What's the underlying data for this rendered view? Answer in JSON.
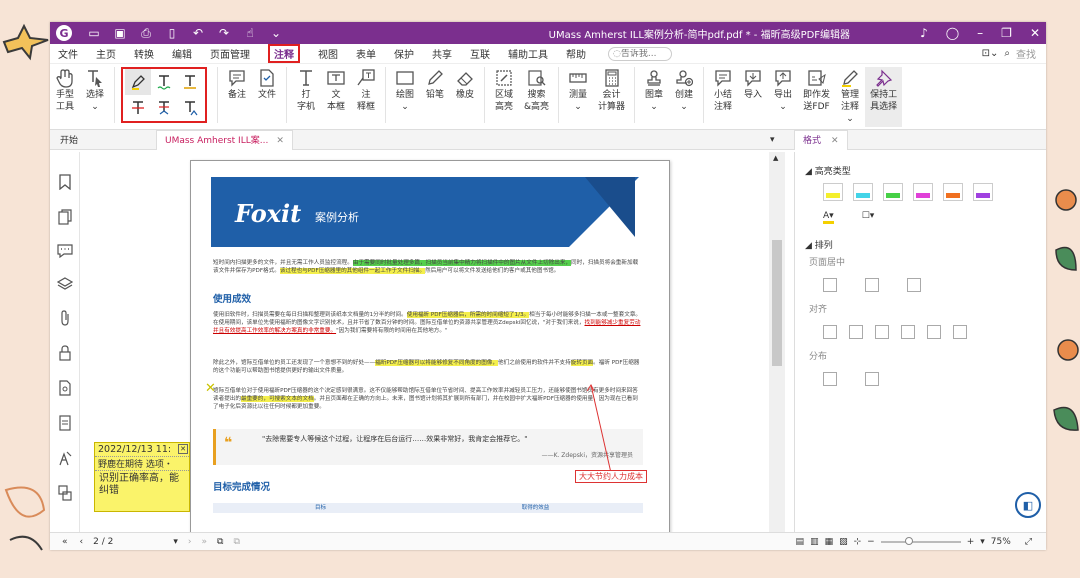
{
  "titlebar": {
    "app_logo": "G",
    "title": "UMass Amherst ILL案例分析-简中pdf.pdf * - 福昕高级PDF编辑器"
  },
  "menubar": {
    "items": [
      "文件",
      "主页",
      "转换",
      "编辑",
      "页面管理",
      "注释",
      "视图",
      "表单",
      "保护",
      "共享",
      "互联",
      "辅助工具",
      "帮助"
    ],
    "active_index": 5,
    "help_placeholder": "告诉我...",
    "search_label": "查找"
  },
  "ribbon": {
    "hand_tool": "手型\n工具",
    "select_tool": "选择",
    "note": "备注",
    "file": "文件",
    "typewriter": "打\n字机",
    "textbox": "文\n本框",
    "callout": "注\n释框",
    "drawing": "绘图",
    "pencil": "铅笔",
    "eraser": "橡皮",
    "area_highlight": "区域\n高亮",
    "search_highlight": "搜索\n&高亮",
    "measure": "测量",
    "calculator": "会计\n计算器",
    "stamp": "图章",
    "create": "创建",
    "summarize": "小结\n注释",
    "import": "导入",
    "export": "导出",
    "send_fdf": "即作发\n送FDF",
    "manage": "管理\n注释",
    "keep_tool": "保持工\n具选择"
  },
  "tabs": {
    "start": "开始",
    "doc": "UMass Amherst ILL案...",
    "format": "格式"
  },
  "document": {
    "brand": "Foxit",
    "brand_sub": "案例分析",
    "para1_a": "短时间内扫描更多的文件，并且无需工作人员监控流程。",
    "para1_hl": "由于需要同时批量处理多篇，扫描员当前集中精力将扫描件中的图片从文件上切除出来，",
    "para1_b": "同时，扫描员将会重新加载该文件并保存为PDF格式。",
    "para1_hl2": "该过程也与PDF压缩器里的其他组件一起工作于文件扫描。",
    "para1_c": "然后用户可以将文件发送给他们的客户或其他图书馆。",
    "h1": "使用成效",
    "para2_a": "使用旧软件时，扫描员需要在每日扫描和整理到该纸本文档量的1分半的时间。",
    "para2_hl": "使用福昕 PDF压缩器后，所需的时间缩短了1/3。",
    "para2_b": "相当于每小时能够多扫描一本或一整套文章。在使用期间，该单位先使用福昕的图像文字识别技术，且并节省了数百分钟的时间。图际互借单位的资源共享管理员Zdepski回忆说，\"对于我们来说，",
    "para2_r": "找到能够减少重复劳动并且有效提高工作效率的解决方案真的非常重要。",
    "para2_c": "\"因为我们需要将有限的时间用在其他地方。\"",
    "para3_a": "除此之外，馆际互借单位的员工还发现了一个意想不到的好处——",
    "para3_hl": "福昕PDF压缩器可以将能够修复不同角度的图像，",
    "para3_b": "他们之前使用的软件并不支持",
    "para3_hl2": "旋转页面",
    "para3_c": "。福昕 PDF压缩器的这个功能可以帮助图书馆提供更好的输出文件质量。",
    "para4_a": "馆际互借单位对于使用福昕PDF压缩器的这个决定感到很满意。这不仅能够帮助馆际互借单位节省时间、提高工作效率并减轻员工压力，还能够使图书馆员有更多时间来回答读者提出的",
    "para4_hl": "最重要的，可搜索文本的文档",
    "para4_b": "。并且页面都在正确的方向上。未来，图书馆计划将其扩展到所有部门，并在校园中扩大福昕PDF压缩器的使用量，因为现在已看到了电子化后资源比以往任何时候都更加重要。",
    "quote_text": "\"去除需要专人等候这个过程，让程序在后台运行……效果非常好，我肯定会推荐它。\"",
    "quote_src": "——K. Zdepski，资源共享管理员",
    "callout": "大大节约人力成本",
    "h2": "目标完成情况",
    "tbl_h1": "目标",
    "tbl_h2": "取得的效益"
  },
  "sticky_note": {
    "header": "2022/12/13 11:",
    "header2": "野鹿在期待  选项・",
    "body": "识别正确率高，能纠错"
  },
  "format_panel": {
    "highlight_type": "高亮类型",
    "swatches": [
      "#f4ef2c",
      "#43d4e8",
      "#46d046",
      "#e040d8",
      "#f07020",
      "#a040e0"
    ],
    "arrange": "排列",
    "page_center": "页面居中",
    "align": "对齐",
    "distribute": "分布"
  },
  "statusbar": {
    "page": "2 / 2",
    "zoom": "75%",
    "zoom_fraction": 0.3
  },
  "colors": {
    "accent": "#7b2f8e",
    "brand_blue": "#1f5fa8",
    "highlight_red": "#e02020"
  }
}
